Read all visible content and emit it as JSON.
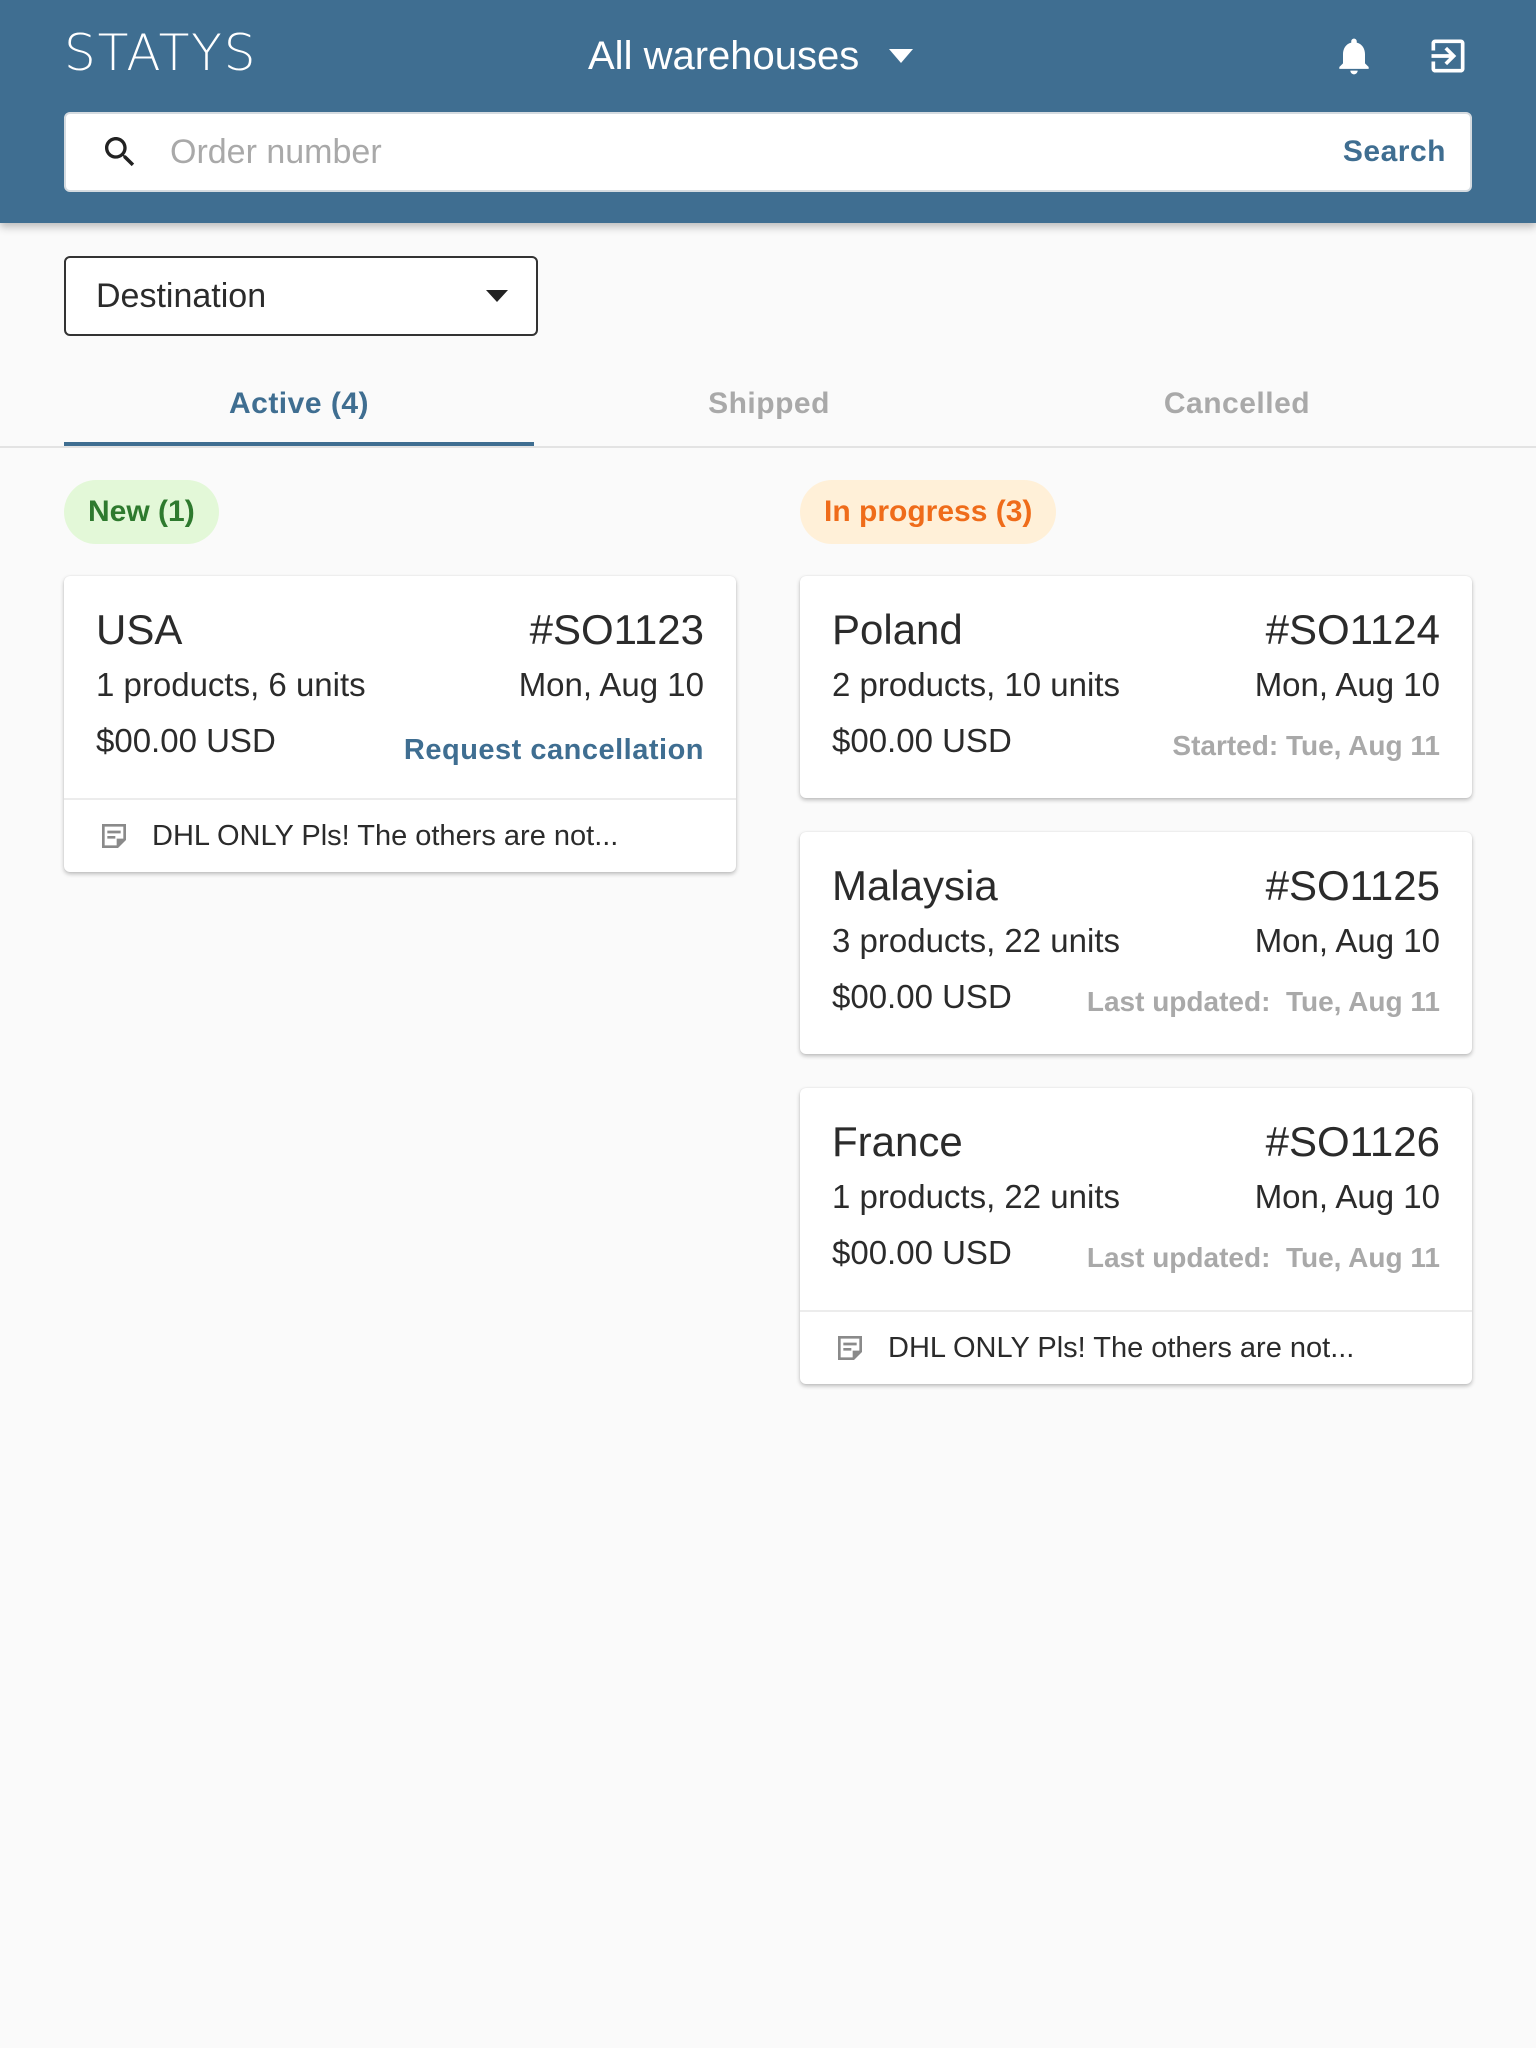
{
  "header": {
    "logo": "STATYS",
    "warehouse_select": "All warehouses",
    "icons": [
      "bell-icon",
      "logout-icon"
    ],
    "colors": {
      "background": "#3f6e91",
      "foreground": "#ffffff"
    }
  },
  "search": {
    "placeholder": "Order number",
    "value": "",
    "button_label": "Search"
  },
  "filter": {
    "destination_label": "Destination"
  },
  "tabs": [
    {
      "label": "Active (4)",
      "active": true
    },
    {
      "label": "Shipped",
      "active": false
    },
    {
      "label": "Cancelled",
      "active": false
    }
  ],
  "columns": {
    "new": {
      "label": "New (1)",
      "color": "#2e7a2e",
      "background": "#e3f8d8",
      "orders": [
        {
          "country": "USA",
          "order_number": "#SO1123",
          "products": "1 products, 6 units",
          "date": "Mon, Aug 10",
          "price": "$00.00 USD",
          "action": "Request cancellation",
          "note": "DHL ONLY Pls! The others are not..."
        }
      ]
    },
    "in_progress": {
      "label": "In progress (3)",
      "color": "#ef6c1a",
      "background": "#fff0d8",
      "orders": [
        {
          "country": "Poland",
          "order_number": "#SO1124",
          "products": "2 products, 10 units",
          "date": "Mon, Aug 10",
          "price": "$00.00 USD",
          "meta": "Started: Tue, Aug 11"
        },
        {
          "country": "Malaysia",
          "order_number": "#SO1125",
          "products": "3 products, 22 units",
          "date": "Mon, Aug 10",
          "price": "$00.00 USD",
          "meta": "Last updated:  Tue, Aug 11"
        },
        {
          "country": "France",
          "order_number": "#SO1126",
          "products": "1 products, 22 units",
          "date": "Mon, Aug 10",
          "price": "$00.00 USD",
          "meta": "Last updated:  Tue, Aug 11",
          "note": "DHL ONLY Pls! The others are not..."
        }
      ]
    }
  }
}
